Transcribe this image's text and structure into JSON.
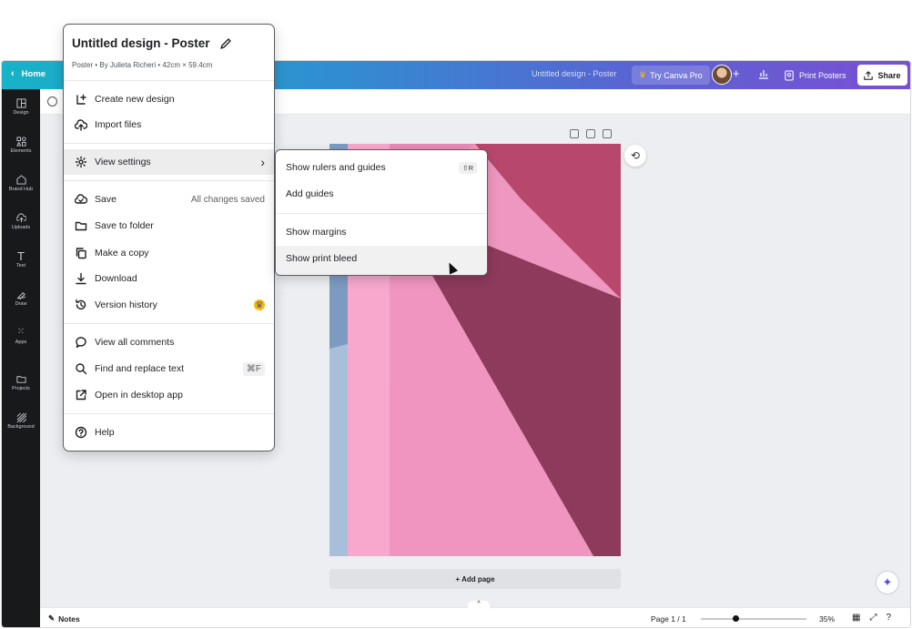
{
  "topbar": {
    "home_label": "Home",
    "design_title": "Untitled design - Poster",
    "try_pro_label": "Try Canva Pro",
    "print_label": "Print Posters",
    "share_label": "Share"
  },
  "sidebar": {
    "items": [
      {
        "label": "Design",
        "icon": "design-icon"
      },
      {
        "label": "Elements",
        "icon": "elements-icon"
      },
      {
        "label": "Brand Hub",
        "icon": "brand-hub-icon"
      },
      {
        "label": "Uploads",
        "icon": "uploads-icon"
      },
      {
        "label": "Text",
        "icon": "text-icon"
      },
      {
        "label": "Draw",
        "icon": "draw-icon"
      },
      {
        "label": "Apps",
        "icon": "apps-icon"
      },
      {
        "label": "Projects",
        "icon": "projects-icon"
      },
      {
        "label": "Background",
        "icon": "background-icon"
      }
    ]
  },
  "canvas": {
    "add_page_label": "+ Add page"
  },
  "bottombar": {
    "notes_label": "Notes",
    "page_indicator": "Page 1 / 1",
    "zoom_level": "35%",
    "zoom_fraction": 0.3
  },
  "menu": {
    "title": "Untitled design - Poster",
    "subtitle": "Poster • By Julieta Richeri • 42cm × 59.4cm",
    "items": [
      {
        "label": "Create new design",
        "icon": "plus-square-icon"
      },
      {
        "label": "Import files",
        "icon": "cloud-upload-icon"
      },
      {
        "label": "View settings",
        "icon": "gear-icon"
      },
      {
        "label": "Save",
        "icon": "cloud-check-icon",
        "right": "All changes saved"
      },
      {
        "label": "Save to folder",
        "icon": "folder-icon"
      },
      {
        "label": "Make a copy",
        "icon": "copy-icon"
      },
      {
        "label": "Download",
        "icon": "download-icon"
      },
      {
        "label": "Version history",
        "icon": "history-icon"
      },
      {
        "label": "View all comments",
        "icon": "comment-icon"
      },
      {
        "label": "Find and replace text",
        "icon": "search-icon",
        "right": "⌘F"
      },
      {
        "label": "Open in desktop app",
        "icon": "external-link-icon"
      },
      {
        "label": "Help",
        "icon": "help-icon"
      }
    ]
  },
  "submenu": {
    "items": [
      {
        "label": "Show rulers and guides",
        "shortcut": "⇧R"
      },
      {
        "label": "Add guides"
      },
      {
        "label": "Show margins"
      },
      {
        "label": "Show print bleed"
      }
    ]
  },
  "colors": {
    "topbar_gradient_start": "#17b3c8",
    "topbar_gradient_end": "#7b4fd2",
    "sidebar_bg": "#18191b",
    "poster_pink": "#f29ac2",
    "poster_wine": "#8e3a5c",
    "crown": "#f5b90f"
  }
}
